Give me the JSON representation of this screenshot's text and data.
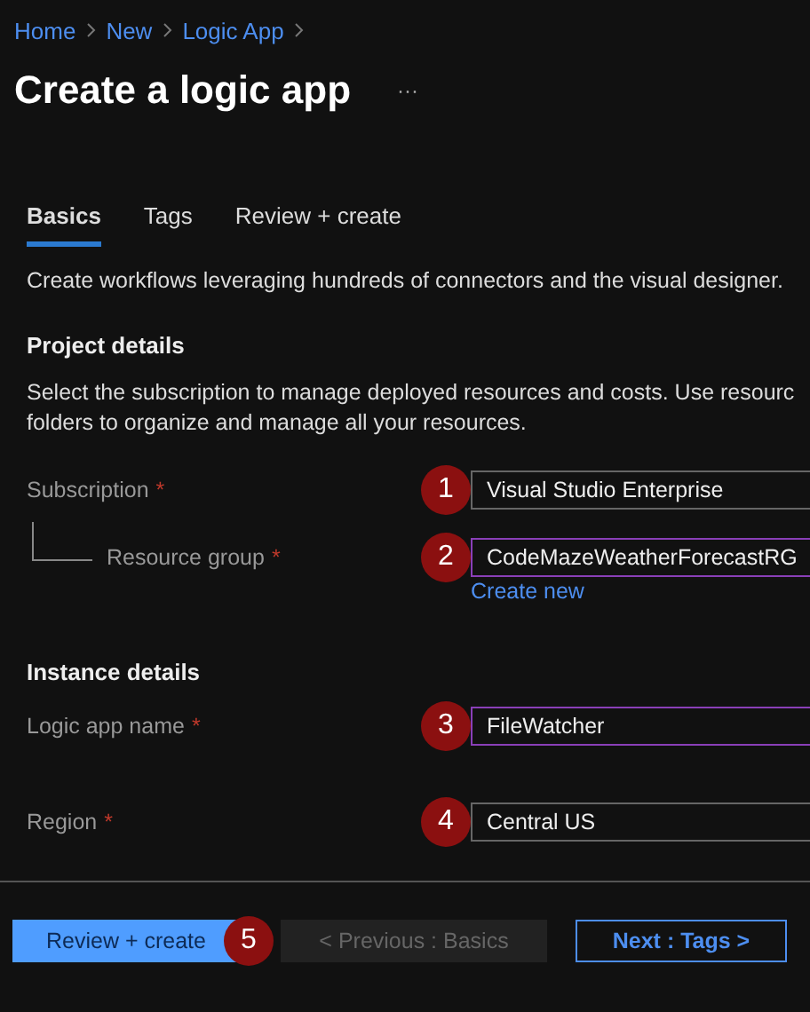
{
  "breadcrumb": [
    {
      "label": "Home"
    },
    {
      "label": "New"
    },
    {
      "label": "Logic App"
    }
  ],
  "title": "Create a logic app",
  "more": "···",
  "tabs": [
    {
      "label": "Basics",
      "selected": true
    },
    {
      "label": "Tags",
      "selected": false
    },
    {
      "label": "Review + create",
      "selected": false
    }
  ],
  "description": "Create workflows leveraging hundreds of connectors and the visual designer.",
  "project_details": {
    "heading": "Project details",
    "lines": [
      "Select the subscription to manage deployed resources and costs. Use resourc",
      "folders to organize and manage all your resources."
    ],
    "fields": [
      {
        "label": "Subscription",
        "required_mark": "*",
        "nested": false,
        "value": "Visual Studio Enterprise",
        "focused": false,
        "marker": "1"
      },
      {
        "label": "Resource group",
        "required_mark": "*",
        "nested": true,
        "value": "CodeMazeWeatherForecastRG",
        "focused": true,
        "marker": "2",
        "link": "Create new"
      }
    ]
  },
  "instance_details": {
    "heading": "Instance details",
    "fields": [
      {
        "label": "Logic app name",
        "required_mark": "*",
        "nested": false,
        "value": "FileWatcher",
        "focused": true,
        "marker": "3"
      },
      {
        "label": "Region",
        "required_mark": "*",
        "nested": false,
        "value": "Central US",
        "focused": false,
        "marker": "4"
      }
    ]
  },
  "footer": {
    "buttons": [
      {
        "label": "Review + create",
        "kind": "primary",
        "disabled": false,
        "marker": "5"
      },
      {
        "label": "< Previous : Basics",
        "kind": "secondary",
        "disabled": true
      },
      {
        "label": "Next : Tags >",
        "kind": "outline",
        "disabled": false
      }
    ]
  }
}
